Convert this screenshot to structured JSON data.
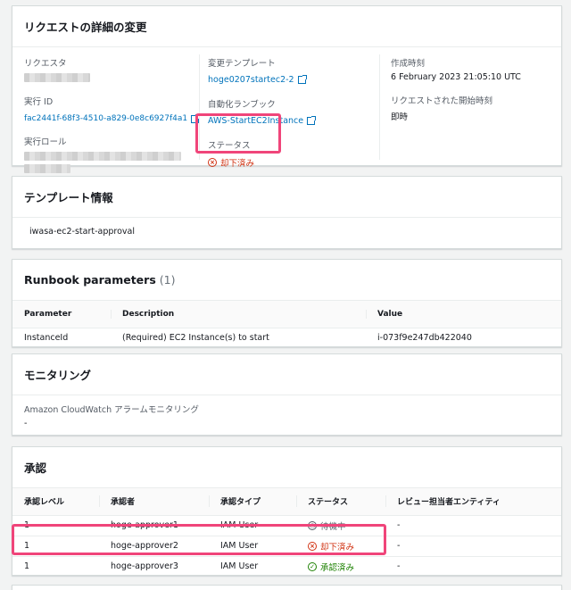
{
  "request_details": {
    "title": "リクエストの詳細の変更",
    "requester_label": "リクエスタ",
    "execution_id_label": "実行 ID",
    "execution_id": "fac2441f-68f3-4510-a829-0e8c6927f4a1",
    "execution_role_label": "実行ロール",
    "template_label": "変更テンプレート",
    "template_value": "hoge0207startec2-2",
    "runbook_label": "自動化ランブック",
    "runbook_value": "AWS-StartEC2Instance",
    "status_label": "ステータス",
    "status_value": "却下済み",
    "created_label": "作成時刻",
    "created_value": "6 February 2023 21:05:10 UTC",
    "requested_start_label": "リクエストされた開始時刻",
    "requested_start_value": "即時"
  },
  "template_info": {
    "title": "テンプレート情報",
    "value": "iwasa-ec2-start-approval"
  },
  "runbook_params": {
    "title": "Runbook parameters",
    "count": "(1)",
    "headers": [
      "Parameter",
      "Description",
      "Value"
    ],
    "rows": [
      [
        "InstanceId",
        "(Required) EC2 Instance(s) to start",
        "i-073f9e247db422040"
      ]
    ]
  },
  "monitoring": {
    "title": "モニタリング",
    "label": "Amazon CloudWatch アラームモニタリング",
    "value": "-"
  },
  "approval": {
    "title": "承認",
    "headers": [
      "承認レベル",
      "承認者",
      "承認タイプ",
      "ステータス",
      "レビュー担当者エンティティ"
    ],
    "rows": [
      {
        "level": "1",
        "approver": "hoge-approver1",
        "type": "IAM User",
        "status": "待機中",
        "entity": "-"
      },
      {
        "level": "1",
        "approver": "hoge-approver2",
        "type": "IAM User",
        "status": "却下済み",
        "entity": "-"
      },
      {
        "level": "1",
        "approver": "hoge-approver3",
        "type": "IAM User",
        "status": "承認済み",
        "entity": "-"
      }
    ]
  },
  "colors": {
    "link": "#0073bb",
    "rejected": "#d13212",
    "approved": "#1d8102",
    "highlight": "#f0457a"
  }
}
